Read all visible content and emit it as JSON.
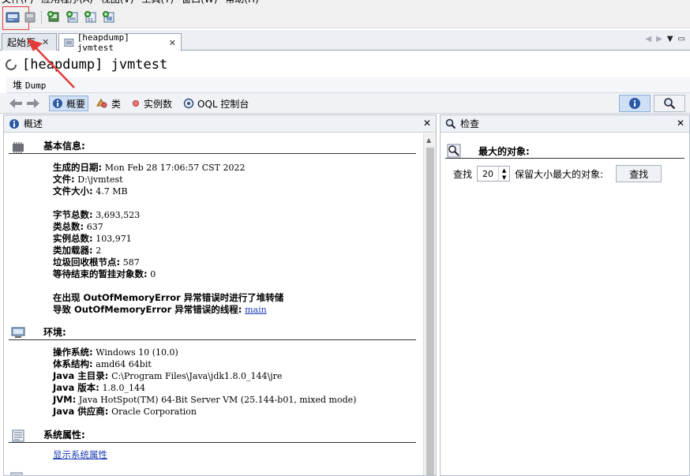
{
  "menubar": [
    "文件(F)",
    "应用程序(A)",
    "视图(V)",
    "工具(T)",
    "窗口(W)",
    "帮助(H)"
  ],
  "tabs": [
    {
      "label": "起始页",
      "close": "✕"
    },
    {
      "label": "[heapdump] jvmtest",
      "close": "✕"
    }
  ],
  "page_title": "[heapdump]  jvmtest",
  "heap_label": {
    "cn": "堆",
    "en": "Dump"
  },
  "view_toolbar": {
    "overview": "概要",
    "classes": "类",
    "instances": "实例数",
    "oql": "OQL 控制台"
  },
  "left_panel": {
    "title": "概述",
    "basic": {
      "title": "基本信息:",
      "rows": [
        {
          "k": "生成的日期:",
          "v": "Mon Feb 28 17:06:57 CST 2022"
        },
        {
          "k": "文件:",
          "v": "D:\\jvmtest"
        },
        {
          "k": "文件大小:",
          "v": "4.7 MB"
        }
      ],
      "stats": [
        {
          "k": "字节总数:",
          "v": "3,693,523"
        },
        {
          "k": "类总数:",
          "v": "637"
        },
        {
          "k": "实例总数:",
          "v": "103,971"
        },
        {
          "k": "类加载器:",
          "v": "2"
        },
        {
          "k": "垃圾回收根节点:",
          "v": "587"
        },
        {
          "k": "等待结束的暂挂对象数:",
          "v": "0"
        }
      ],
      "oom1": "在出现 OutOfMemoryError 异常错误时进行了堆转储",
      "oom2_prefix": "导致 OutOfMemoryError 异常错误的线程:",
      "oom2_link": "main"
    },
    "env": {
      "title": "环境:",
      "rows": [
        {
          "k": "操作系统:",
          "v": "Windows 10 (10.0)"
        },
        {
          "k": "体系结构:",
          "v": "amd64 64bit"
        },
        {
          "k": "Java 主目录:",
          "v": "C:\\Program Files\\Java\\jdk1.8.0_144\\jre"
        },
        {
          "k": "Java 版本:",
          "v": "1.8.0_144"
        },
        {
          "k": "JVM:",
          "v": "Java HotSpot(TM) 64-Bit Server VM (25.144-b01, mixed mode)"
        },
        {
          "k": "Java 供应商:",
          "v": "Oracle Corporation"
        }
      ]
    },
    "sysprops": {
      "title": "系统属性:",
      "link": "显示系统属性"
    }
  },
  "right_panel": {
    "title": "检查",
    "section_title": "最大的对象:",
    "find_label": "查找",
    "count": "20",
    "suffix": "保留大小最大的对象:",
    "button": "查找"
  },
  "colors": {
    "highlight": "#e23b3b",
    "link": "#1a3ab3",
    "selected": "#cfe0f5"
  }
}
